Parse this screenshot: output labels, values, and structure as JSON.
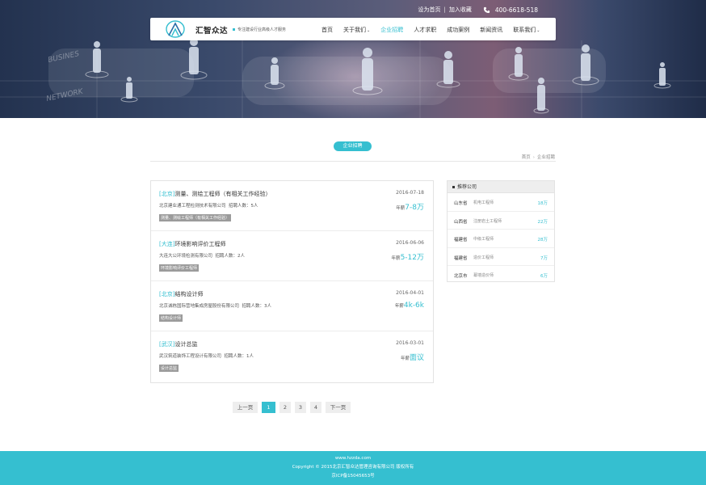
{
  "header": {
    "set_home": "设为首页",
    "sep": "|",
    "add_fav": "加入收藏",
    "phone": "400-6618-518",
    "brand": "汇智众达",
    "tagline": "专注建设行业高级人才服务",
    "nav": [
      {
        "label": "首页",
        "dropdown": false,
        "active": false
      },
      {
        "label": "关于我们",
        "dropdown": true,
        "active": false
      },
      {
        "label": "企业招聘",
        "dropdown": false,
        "active": true
      },
      {
        "label": "人才求职",
        "dropdown": false,
        "active": false
      },
      {
        "label": "成功案例",
        "dropdown": false,
        "active": false
      },
      {
        "label": "新闻资讯",
        "dropdown": false,
        "active": false
      },
      {
        "label": "联系我们",
        "dropdown": true,
        "active": false
      }
    ],
    "hero_words": [
      "BUSINES",
      "NETWORK"
    ]
  },
  "section": {
    "title": "企业招聘",
    "breadcrumb": [
      "首页",
      "企业招聘"
    ],
    "breadcrumb_sep": "›"
  },
  "jobs": [
    {
      "city": "[北京]",
      "title": "测量、测绘工程师（有相关工作经验）",
      "date": "2016-07-18",
      "company": "北京建业通工程检测技术有限公司",
      "headcount": "招聘人数：5人",
      "salary_label": "年薪",
      "salary": "7-8万",
      "tag": "测量、测绘工程师（有相关工作经验）"
    },
    {
      "city": "[大连]",
      "title": "环境影响评价工程师",
      "date": "2016-06-06",
      "company": "大连大公环境检测有限公司",
      "headcount": "招聘人数：2人",
      "salary_label": "年薪",
      "salary": "5-12万",
      "tag": "环境影响评价工程师"
    },
    {
      "city": "[北京]",
      "title": "结构设计师",
      "date": "2016-04-01",
      "company": "北京诚栋国际营地集成房屋股份有限公司",
      "headcount": "招聘人数：3人",
      "salary_label": "年薪",
      "salary": "4k-6k",
      "tag": "结构设计师"
    },
    {
      "city": "[武汉]",
      "title": "设计总监",
      "date": "2016-03-01",
      "company": "武汉筑道装饰工程设计有限公司",
      "headcount": "招聘人数：1人",
      "salary_label": "年薪",
      "salary": "面议",
      "tag": "设计总监"
    }
  ],
  "sidebar": {
    "title": "推荐公司",
    "companies": [
      {
        "province": "山东省",
        "position": "机电工程师",
        "salary": "18万"
      },
      {
        "province": "山西省",
        "position": "注册岩土工程师",
        "salary": "22万"
      },
      {
        "province": "福建省",
        "position": "中级工程师",
        "salary": "28万"
      },
      {
        "province": "福建省",
        "position": "造价工程师",
        "salary": "7万"
      },
      {
        "province": "北京市",
        "position": "幕墙造价师",
        "salary": "6万"
      }
    ]
  },
  "pagination": {
    "prev": "上一页",
    "pages": [
      "1",
      "2",
      "3",
      "4"
    ],
    "current": "1",
    "next": "下一页"
  },
  "footer": {
    "url": "www.hzzda.com",
    "copyright": "Copyright © 2015北京汇智众达管理咨询有限公司 版权所有",
    "icp": "京ICP备15045653号"
  },
  "colors": {
    "accent": "#35bfd0",
    "footer_bg": "#35bfd0",
    "tag_bg": "#9b9b9b"
  },
  "icons": [
    "phone-icon",
    "logo-icon",
    "chevron-down-icon"
  ]
}
